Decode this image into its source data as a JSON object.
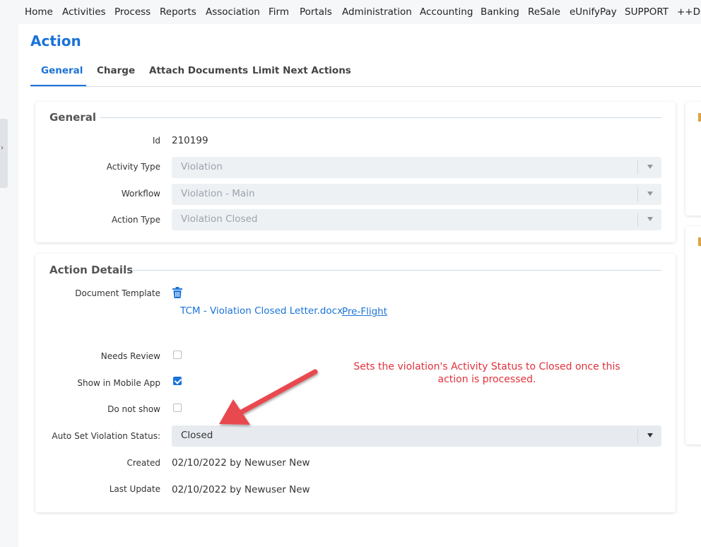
{
  "nav": [
    "Home",
    "Activities",
    "Process",
    "Reports",
    "Association",
    "Firm",
    "Portals",
    "Administration",
    "Accounting",
    "Banking",
    "ReSale",
    "eUnifyPay",
    "SUPPORT",
    "++DEV"
  ],
  "page": {
    "title": "Action"
  },
  "tabs": [
    "General",
    "Charge",
    "Attach Documents",
    "Limit Next Actions"
  ],
  "general": {
    "title": "General",
    "id_label": "Id",
    "id_value": "210199",
    "activity_type_label": "Activity Type",
    "activity_type_value": "Violation",
    "workflow_label": "Workflow",
    "workflow_value": "Violation - Main",
    "action_type_label": "Action Type",
    "action_type_value": "Violation Closed"
  },
  "details": {
    "title": "Action Details",
    "document_template_label": "Document Template",
    "document_link": "TCM - Violation Closed Letter.docx",
    "preflight_link": "Pre-Flight",
    "needs_review_label": "Needs Review",
    "show_mobile_label": "Show in Mobile App",
    "do_not_show_label": "Do not show",
    "auto_status_label": "Auto Set Violation Status:",
    "auto_status_value": "Closed",
    "created_label": "Created",
    "created_value": "02/10/2022 by Newuser New",
    "last_update_label": "Last Update",
    "last_update_value": "02/10/2022 by Newuser New"
  },
  "annotation": {
    "text": "Sets the violation's Activity Status to Closed once this action is processed."
  },
  "colors": {
    "accent": "#1a73d8",
    "annotation": "#e0323c",
    "arrow": "#e84850"
  }
}
